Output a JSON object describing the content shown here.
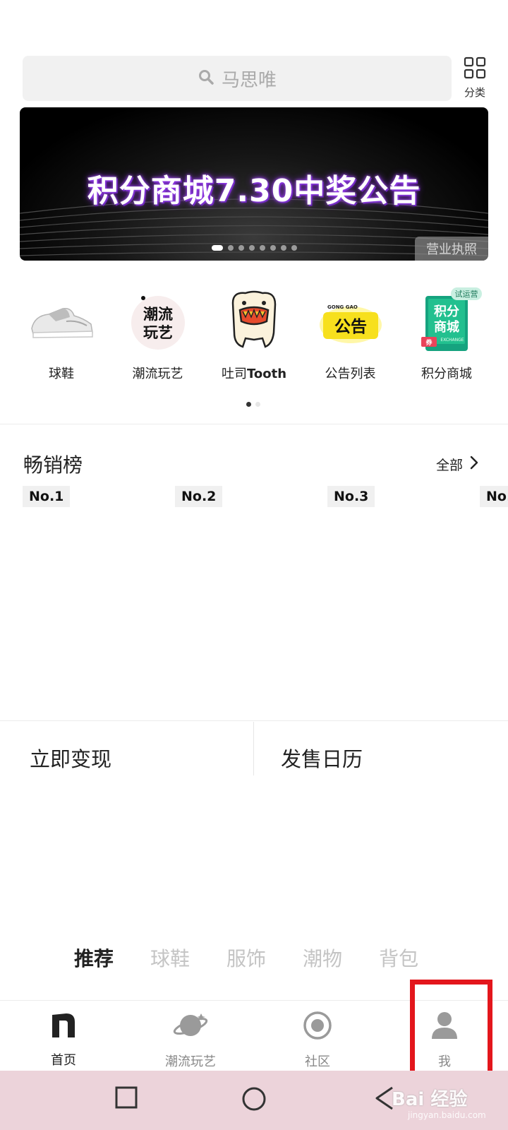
{
  "search": {
    "placeholder": "马思唯"
  },
  "category_button": {
    "label": "分类"
  },
  "banner": {
    "title": "积分商城7.30中奖公告",
    "license_label": "营业执照",
    "dot_count": 8,
    "active_index": 0
  },
  "quick_nav": [
    {
      "label": "球鞋",
      "icon": "sneaker-icon"
    },
    {
      "label": "潮流玩艺",
      "icon": "trend-toys-icon",
      "badge_text": "潮流玩艺"
    },
    {
      "label_prefix": "吐司",
      "label_bold": "Tooth",
      "icon": "tooth-mascot-icon"
    },
    {
      "label": "公告列表",
      "icon": "announcement-icon",
      "badge_text": "公告",
      "badge_sub": "GONG GAO"
    },
    {
      "label": "积分商城",
      "icon": "points-mall-icon",
      "badge_text": "积分商城",
      "corner_tag": "试运营",
      "sub_tag": "EXCHANGE",
      "ticket_text": "券"
    }
  ],
  "bestsellers": {
    "title": "畅销榜",
    "see_all": "全部",
    "ranks": [
      "No.1",
      "No.2",
      "No.3",
      "No."
    ]
  },
  "feature_cards": [
    {
      "title": "立即变现"
    },
    {
      "title": "发售日历"
    }
  ],
  "category_tabs": [
    "推荐",
    "球鞋",
    "服饰",
    "潮物",
    "背包"
  ],
  "tabbar": [
    {
      "label": "首页",
      "icon": "home-n-icon",
      "active": true
    },
    {
      "label": "潮流玩艺",
      "icon": "planet-icon",
      "active": false
    },
    {
      "label": "社区",
      "icon": "community-target-icon",
      "active": false
    },
    {
      "label": "我",
      "icon": "profile-icon",
      "active": false
    }
  ],
  "watermark": {
    "text": "Bai 经验",
    "sub": "jingyan.baidu.com"
  },
  "colors": {
    "highlight": "#e3161c",
    "sysnav_bg": "#ecd3da",
    "banner_glow": "#8a2be2"
  }
}
